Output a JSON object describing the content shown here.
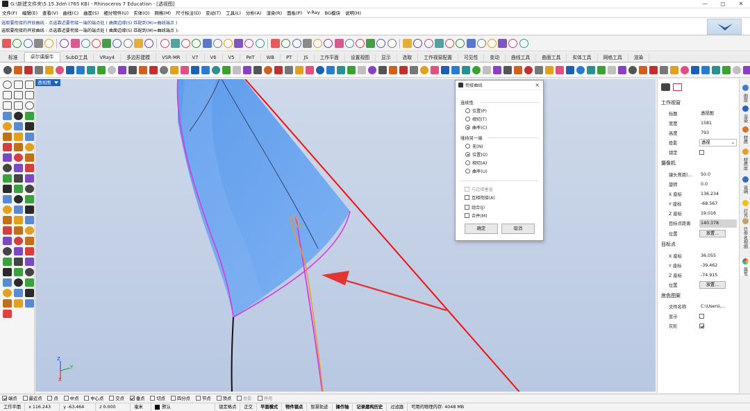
{
  "window": {
    "title": "G:\\新建文件夹\\5.15.3dm (765 KB) - Rhinoceros 7 Education - [透视图]",
    "controls": {
      "minimize": "—",
      "maximize": "◻",
      "close": "✕"
    }
  },
  "menu": [
    "文件(F)",
    "编辑(E)",
    "查看(V)",
    "曲线(C)",
    "曲面(S)",
    "细分物件(U)",
    "实体(O)",
    "网格(M)",
    "尺寸标注(D)",
    "变动(T)",
    "工具(L)",
    "分析(A)",
    "渲染(R)",
    "面板(P)",
    "V-Ray",
    "BG模块",
    "说明(H)"
  ],
  "command": {
    "line1": "选取要衔接的开放曲线 - 点选靠近要衔接一端的端点处 ( 曲面边缘(S)  匹配到(M)=曲线端点 )",
    "line2": "选取要衔接的开放曲线 - 点选靠近要衔接一端的端点处 ( 曲面边缘(S)  匹配到(M)=曲线端点 ):"
  },
  "tabs": [
    "标准",
    "卓尔课服牛",
    "SubD工具",
    "VRay4",
    "多边形建模",
    "VSR-MR",
    "V7",
    "V6",
    "V5",
    "PeT",
    "WB",
    "PT",
    "JS",
    "工作平面",
    "设置视图",
    "显示",
    "选取",
    "工作视窗配置",
    "可见性",
    "变动",
    "曲线工具",
    "曲面工具",
    "实体工具",
    "网格工具",
    "渲染"
  ],
  "active_tab": "卓尔课服牛",
  "viewport": {
    "label": "透视图",
    "axes": {
      "z": "Z",
      "y": "Y",
      "x": "X"
    }
  },
  "dialog": {
    "title": "衔接曲线",
    "close": "×",
    "continuity_label": "连续性",
    "continuity_options": [
      {
        "label": "位置(P)",
        "checked": false
      },
      {
        "label": "相切(T)",
        "checked": false
      },
      {
        "label": "曲率(C)",
        "checked": true
      }
    ],
    "maintain_label": "维持另一端",
    "maintain_options": [
      {
        "label": "无(N)",
        "checked": false
      },
      {
        "label": "位置(O)",
        "checked": true
      },
      {
        "label": "相切(A)",
        "checked": false
      },
      {
        "label": "曲率(U)",
        "checked": false
      }
    ],
    "checkboxes": [
      {
        "label": "与边缘垂直",
        "checked": false,
        "disabled": true
      },
      {
        "label": "互相衔接(A)",
        "checked": false,
        "disabled": false
      },
      {
        "label": "组合(J)",
        "checked": false,
        "disabled": false
      },
      {
        "label": "合并(M)",
        "checked": false,
        "disabled": false
      }
    ],
    "ok": "确定",
    "cancel": "取消"
  },
  "properties": {
    "viewport_section": "工作视窗",
    "title_label": "标题",
    "title_value": "透视图",
    "width_label": "宽度",
    "width_value": "1581",
    "height_label": "高度",
    "height_value": "793",
    "projection_label": "投影",
    "projection_value": "透视",
    "lock_label": "锁定",
    "camera_section": "摄像机",
    "lens_label": "镜头焦距(...",
    "lens_value": "50.0",
    "rotation_label": "旋转",
    "rotation_value": "0.0",
    "cx_label": "X 座标",
    "cx_value": "136.234",
    "cy_label": "Y 座标",
    "cy_value": "-68.567",
    "cz_label": "Z 座标",
    "cz_value": "19.016",
    "targetdist_label": "目标点距离",
    "targetdist_value": "140.378",
    "position_label": "位置",
    "place_button": "放置...",
    "target_section": "目标点",
    "tx_label": "X 座标",
    "tx_value": "36.055",
    "ty_label": "Y 座标",
    "ty_value": "-39.462",
    "tz_label": "Z 座标",
    "tz_value": "-74.915",
    "tposition_label": "位置",
    "tplace_button": "放置...",
    "bg_section": "底色图案",
    "filename_label": "文件名称",
    "filename_value": "C:\\Users\\...",
    "show_label": "显示",
    "gray_label": "灰阶",
    "gray_checked": true
  },
  "right_tabs": [
    "图层",
    "渲染",
    "材质",
    "材质库",
    "说明",
    "灯光",
    "已命名视图",
    "属性"
  ],
  "osnaps": [
    {
      "label": "端点",
      "checked": true
    },
    {
      "label": "最近点",
      "checked": false
    },
    {
      "label": "点",
      "checked": false
    },
    {
      "label": "中点",
      "checked": false
    },
    {
      "label": "中心点",
      "checked": false
    },
    {
      "label": "交点",
      "checked": false
    },
    {
      "label": "垂点",
      "checked": true
    },
    {
      "label": "切点",
      "checked": false
    },
    {
      "label": "四分点",
      "checked": false
    },
    {
      "label": "节点",
      "checked": false
    },
    {
      "label": "顶点",
      "checked": false
    },
    {
      "label": "投影",
      "checked": false,
      "disabled": true
    },
    {
      "label": "停用",
      "checked": false,
      "disabled": true
    }
  ],
  "status": {
    "cplane": "工作平面",
    "x": "x 116.243",
    "y": "y -63.464",
    "z": "z 0.000",
    "unit": "毫米",
    "layer": "默认",
    "items": [
      "锁定格点",
      "正交",
      "平面模式",
      "物件锁点",
      "智慧轨迹",
      "操作轴",
      "记录建构历史",
      "过滤器"
    ],
    "bold_items": [
      "平面模式",
      "物件锁点",
      "操作轴",
      "记录建构历史"
    ],
    "memory": "可用的物理内存: 4048 MB"
  },
  "colors": {
    "viewport_bg": "#c4d2e8",
    "surface": "#6fa6ee",
    "edge_magenta": "#d43be0",
    "red_line": "#ee1111",
    "accent": "#1f63b9"
  }
}
